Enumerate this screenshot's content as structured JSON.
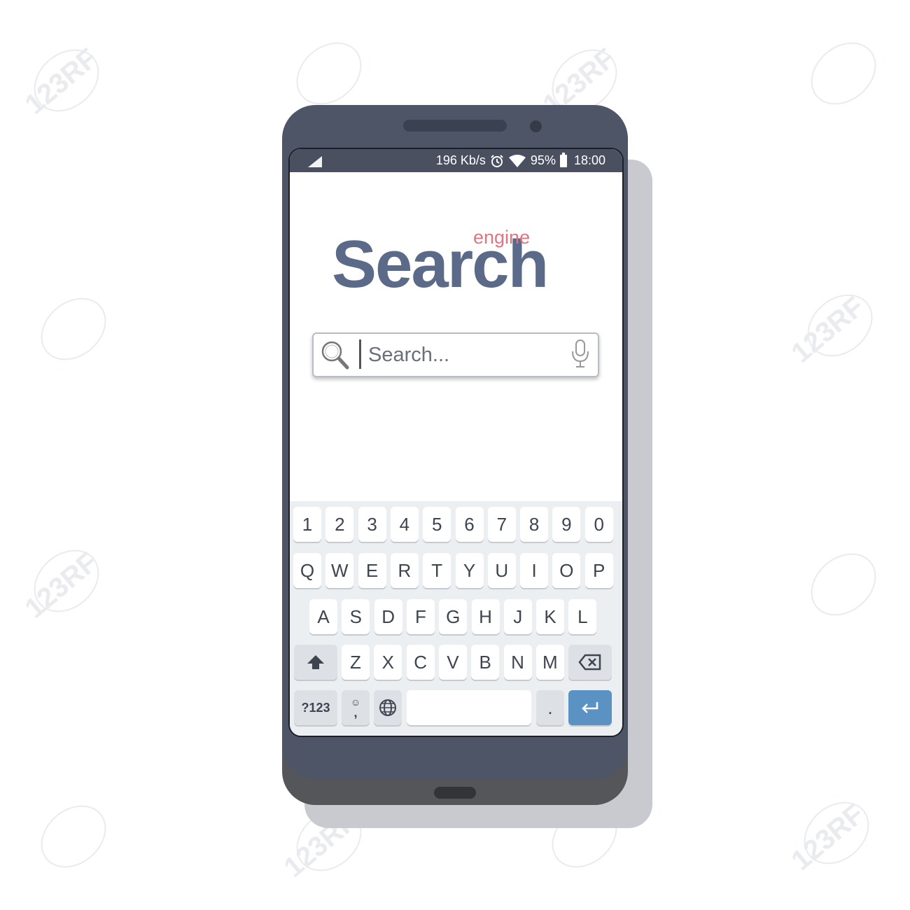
{
  "status_bar": {
    "speed": "196 Kb/s",
    "battery": "95%",
    "time": "18:00",
    "icons": [
      "signal-icon",
      "alarm-icon",
      "wifi-icon",
      "battery-icon"
    ]
  },
  "logo": {
    "main": "Search",
    "sub": "engine",
    "main_color": "#5b6a88",
    "sub_color": "#e07580"
  },
  "search": {
    "placeholder": "Search...",
    "value": ""
  },
  "keyboard": {
    "number_row": [
      "1",
      "2",
      "3",
      "4",
      "5",
      "6",
      "7",
      "8",
      "9",
      "0"
    ],
    "row1": [
      "Q",
      "W",
      "E",
      "R",
      "T",
      "Y",
      "U",
      "I",
      "O",
      "P"
    ],
    "row2": [
      "A",
      "S",
      "D",
      "F",
      "G",
      "H",
      "J",
      "K",
      "L"
    ],
    "row3": [
      "Z",
      "X",
      "C",
      "V",
      "B",
      "N",
      "M"
    ],
    "symbols_key": "?123",
    "comma_key": ",",
    "period_key": ".",
    "enter_color": "#5a92c4"
  },
  "watermark": "123RF",
  "colors": {
    "phone_body": "#4d5567",
    "status_bar": "#4a5060"
  }
}
